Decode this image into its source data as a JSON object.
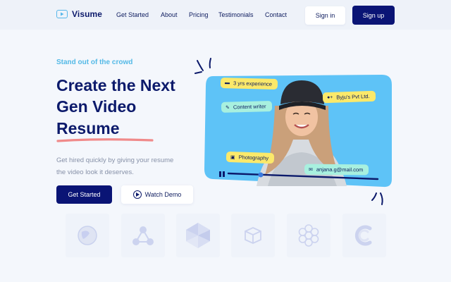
{
  "header": {
    "brand": "Visume",
    "nav": [
      "Get Started",
      "About",
      "Pricing",
      "Testimonials",
      "Contact"
    ],
    "signin_label": "Sign in",
    "signup_label": "Sign up"
  },
  "hero": {
    "kicker": "Stand out of the crowd",
    "headline_lines": [
      "Create the Next",
      "Gen Video",
      "Resume"
    ],
    "description_lines": [
      "Get hired quickly by giving your resume",
      "the video look it deserves."
    ],
    "primary_cta": "Get Started",
    "secondary_cta": "Watch Demo"
  },
  "profile_tags": {
    "experience": "3 yrs experience",
    "company": "Byju's Pvt Ltd.",
    "role": "Content writer",
    "hobby": "Photography",
    "email": "anjana.g@mail.com"
  },
  "colors": {
    "navy": "#0c1a6b",
    "accent_blue": "#53b9e6",
    "card_blue": "#5ec3f7",
    "tag_yellow": "#fbe96a",
    "tag_mint": "#a8f0df",
    "underline_red": "#f08a8a"
  },
  "partner_logos": [
    "globe-logo",
    "network-logo",
    "cube-gem-logo",
    "box-logo",
    "flower-logo",
    "c-mark-logo"
  ]
}
